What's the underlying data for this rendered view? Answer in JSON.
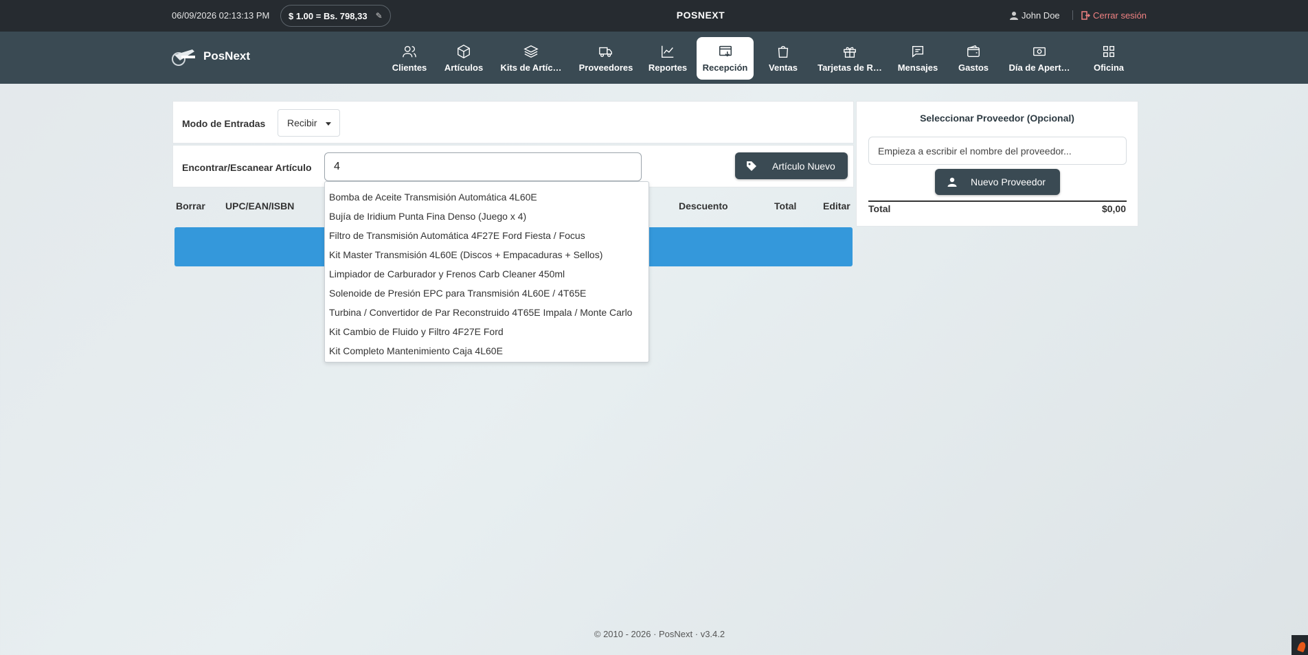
{
  "topbar": {
    "datetime": "06/09/2026 02:13:13 PM",
    "rate": "$ 1.00 = Bs. 798,33",
    "title": "POSNEXT",
    "user": "John Doe",
    "logout": "Cerrar sesión"
  },
  "navbar": {
    "brand": "PosNext",
    "items": [
      {
        "label": "Clientes",
        "icon": "users-icon"
      },
      {
        "label": "Artículos",
        "icon": "box-icon"
      },
      {
        "label": "Kits de Artíc…",
        "icon": "layers-icon"
      },
      {
        "label": "Proveedores",
        "icon": "truck-icon"
      },
      {
        "label": "Reportes",
        "icon": "chart-line-icon"
      },
      {
        "label": "Recepción",
        "icon": "inbox-download-icon",
        "active": true
      },
      {
        "label": "Ventas",
        "icon": "shopping-bag-icon"
      },
      {
        "label": "Tarjetas de R…",
        "icon": "gift-icon"
      },
      {
        "label": "Mensajes",
        "icon": "message-icon"
      },
      {
        "label": "Gastos",
        "icon": "wallet-icon"
      },
      {
        "label": "Día de Apert…",
        "icon": "cash-icon"
      },
      {
        "label": "Oficina",
        "icon": "grid-icon"
      }
    ]
  },
  "main": {
    "mode_label": "Modo de Entradas",
    "mode_value": "Recibir",
    "find_label": "Encontrar/Escanear Artículo",
    "find_value": "4",
    "new_item_button": "Artículo Nuevo",
    "columns": {
      "delete": "Borrar",
      "upc": "UPC/EAN/ISBN",
      "discount": "Descuento",
      "total": "Total",
      "edit": "Editar"
    }
  },
  "dropdown": {
    "options": [
      "Bomba de Aceite Transmisión Automática 4L60E",
      "Bujía de Iridium Punta Fina Denso (Juego x 4)",
      "Filtro de Transmisión Automática 4F27E Ford Fiesta / Focus",
      "Kit Master Transmisión 4L60E (Discos + Empacaduras + Sellos)",
      "Limpiador de Carburador y Frenos Carb Cleaner 450ml",
      "Solenoide de Presión EPC para Transmisión 4L60E / 4T65E",
      "Turbina / Convertidor de Par Reconstruido 4T65E Impala / Monte Carlo",
      "Kit Cambio de Fluido y Filtro 4F27E Ford",
      "Kit Completo Mantenimiento Caja 4L60E"
    ]
  },
  "supplier": {
    "title": "Seleccionar Proveedor (Opcional)",
    "placeholder": "Empieza a escribir el nombre del proveedor...",
    "new_button": "Nuevo Proveedor",
    "total_label": "Total",
    "total_value": "$0,00"
  },
  "footer": {
    "text": "© 2010 - 2026 · PosNext · v3.4.2"
  },
  "colors": {
    "topbar": "#262b30",
    "navbar": "#3a4a53",
    "accent_blue": "#3498db",
    "logout": "#f08282"
  }
}
